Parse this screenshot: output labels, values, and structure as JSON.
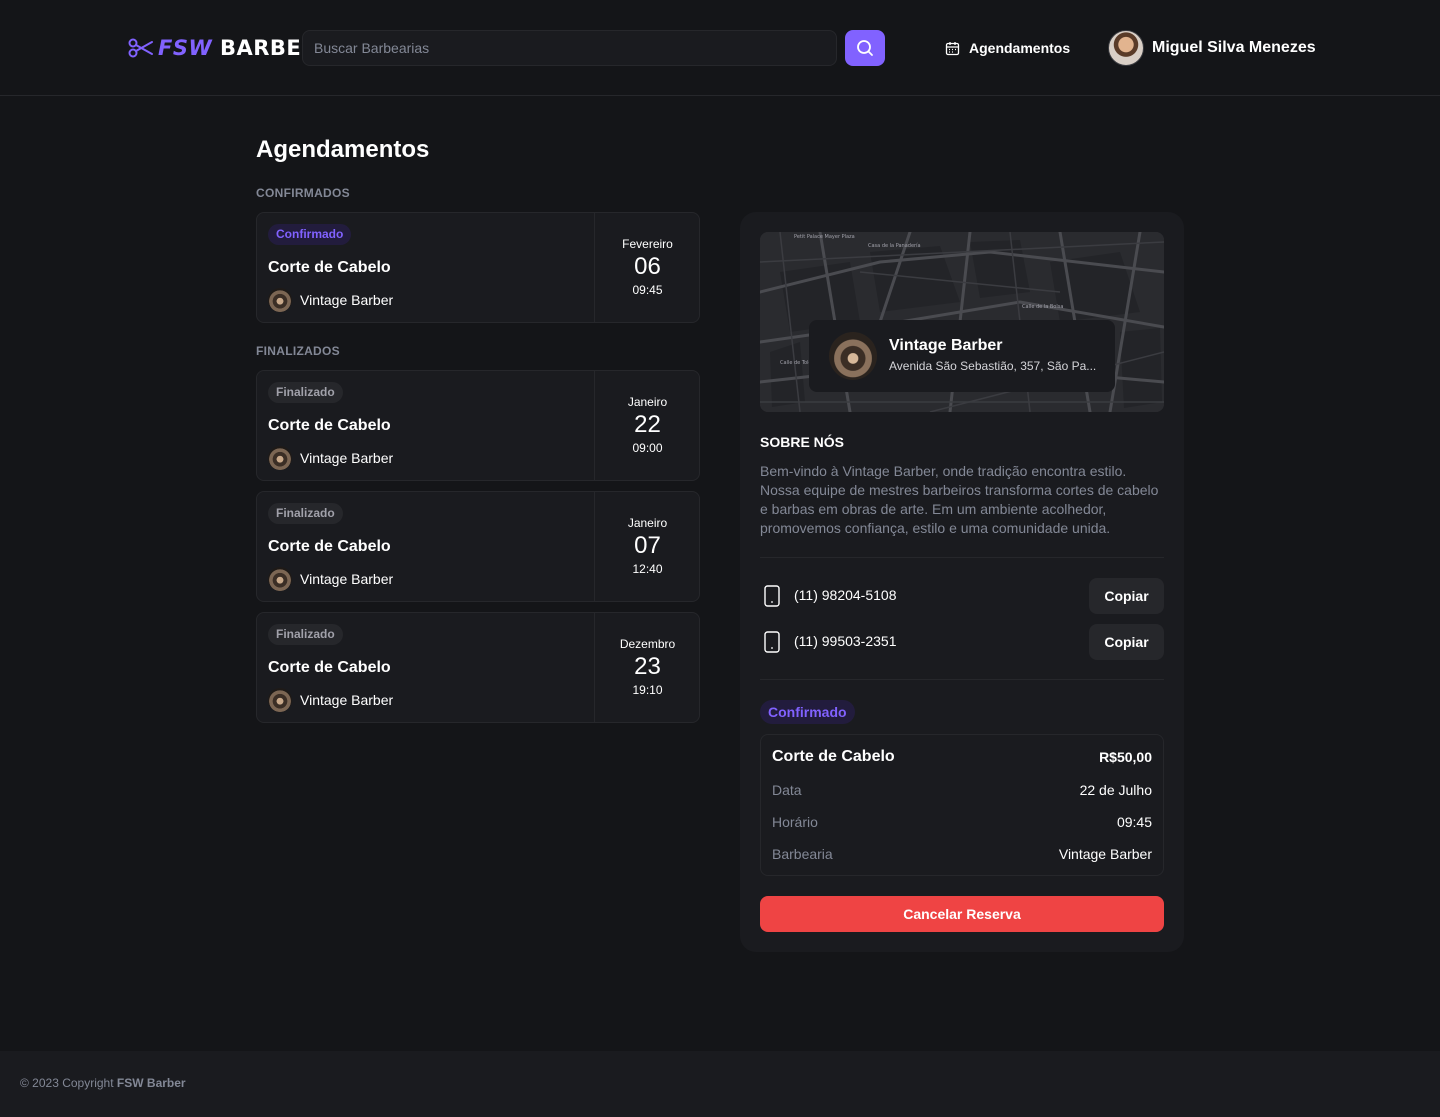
{
  "header": {
    "logo": {
      "main": "FSW",
      "secondary": "BARBER"
    },
    "search_placeholder": "Buscar Barbearias",
    "nav_bookings": "Agendamentos",
    "user_name": "Miguel Silva Menezes"
  },
  "page": {
    "title": "Agendamentos",
    "confirmed_label": "CONFIRMADOS",
    "finished_label": "FINALIZADOS"
  },
  "confirmed_bookings": [
    {
      "status": "Confirmado",
      "service": "Corte de Cabelo",
      "shop": "Vintage Barber",
      "month": "Fevereiro",
      "day": "06",
      "time": "09:45"
    }
  ],
  "finished_bookings": [
    {
      "status": "Finalizado",
      "service": "Corte de Cabelo",
      "shop": "Vintage Barber",
      "month": "Janeiro",
      "day": "22",
      "time": "09:00"
    },
    {
      "status": "Finalizado",
      "service": "Corte de Cabelo",
      "shop": "Vintage Barber",
      "month": "Janeiro",
      "day": "07",
      "time": "12:40"
    },
    {
      "status": "Finalizado",
      "service": "Corte de Cabelo",
      "shop": "Vintage Barber",
      "month": "Dezembro",
      "day": "23",
      "time": "19:10"
    }
  ],
  "details": {
    "map_labels": [
      "Petit Palace Mayer Plaza",
      "Casa de la Panadería",
      "Calle de la Bolsa",
      "Calle de Toledo"
    ],
    "shop_name": "Vintage Barber",
    "shop_address": "Avenida São Sebastião, 357, São Pa...",
    "about_title": "SOBRE NÓS",
    "about_text": "Bem-vindo à Vintage Barber, onde tradição encontra estilo. Nossa equipe de mestres barbeiros transforma cortes de cabelo e barbas em obras de arte. Em um ambiente acolhedor, promovemos confiança, estilo e uma comunidade unida.",
    "phones": [
      {
        "number": "(11) 98204-5108",
        "copy_label": "Copiar"
      },
      {
        "number": "(11) 99503-2351",
        "copy_label": "Copiar"
      }
    ],
    "status": "Confirmado",
    "summary": {
      "service": "Corte de Cabelo",
      "price": "R$50,00",
      "rows": [
        {
          "label": "Data",
          "value": "22 de Julho"
        },
        {
          "label": "Horário",
          "value": "09:45"
        },
        {
          "label": "Barbearia",
          "value": "Vintage Barber"
        }
      ]
    },
    "cancel_label": "Cancelar Reserva"
  },
  "footer": {
    "prefix": "© 2023 Copyright",
    "brand": "FSW Barber"
  },
  "colors": {
    "accent": "#8162ff",
    "background": "#141518",
    "card": "#1a1b1f",
    "border": "#26272b",
    "danger": "#ef4444",
    "muted": "#838896"
  },
  "icons": [
    "scissors-logo-icon",
    "search-icon",
    "calendar-icon",
    "smartphone-icon"
  ]
}
